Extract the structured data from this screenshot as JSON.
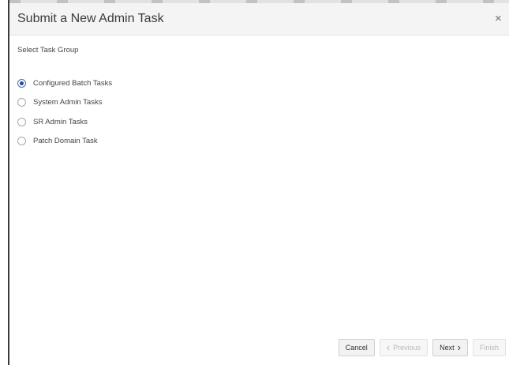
{
  "dialog": {
    "title": "Submit a New Admin Task",
    "close_icon": "close-icon",
    "close_glyph": "×"
  },
  "task_group": {
    "label": "Select Task Group",
    "options": [
      {
        "label": "Configured Batch Tasks",
        "selected": true
      },
      {
        "label": "System Admin Tasks",
        "selected": false
      },
      {
        "label": "SR Admin Tasks",
        "selected": false
      },
      {
        "label": "Patch Domain Task",
        "selected": false
      }
    ]
  },
  "footer": {
    "cancel_label": "Cancel",
    "previous_label": "Previous",
    "next_label": "Next",
    "finish_label": "Finish",
    "previous_icon": "chevron-left-icon",
    "next_icon": "chevron-right-icon"
  },
  "colors": {
    "accent": "#1f4e99",
    "header_bg": "#f4f4f4"
  }
}
